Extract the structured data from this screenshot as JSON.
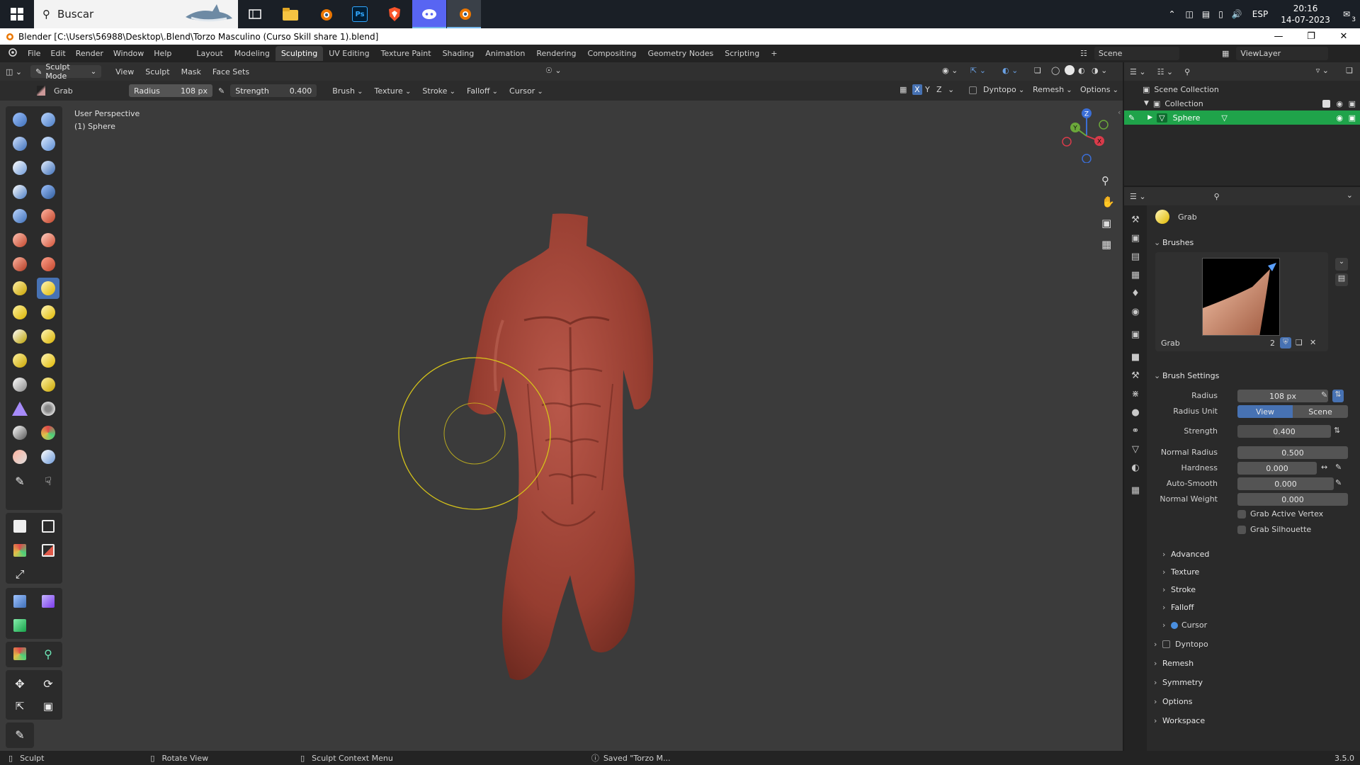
{
  "taskbar": {
    "search_placeholder": "Buscar",
    "time": "20:16",
    "date": "14-07-2023",
    "language": "ESP",
    "notifications": "3",
    "apps": [
      "task-view",
      "file-explorer",
      "blender",
      "photoshop",
      "brave",
      "discord",
      "blender-active"
    ]
  },
  "title": "Blender [C:\\Users\\56988\\Desktop\\.Blend\\Torzo Masculino (Curso Skill share 1).blend]",
  "menus": [
    "File",
    "Edit",
    "Render",
    "Window",
    "Help"
  ],
  "workspaces": [
    "Layout",
    "Modeling",
    "Sculpting",
    "UV Editing",
    "Texture Paint",
    "Shading",
    "Animation",
    "Rendering",
    "Compositing",
    "Geometry Nodes",
    "Scripting"
  ],
  "active_workspace": "Sculpting",
  "scene": "Scene",
  "view_layer": "ViewLayer",
  "header": {
    "mode": "Sculpt Mode",
    "menus": [
      "View",
      "Sculpt",
      "Mask",
      "Face Sets"
    ],
    "brush_name": "Grab",
    "radius_label": "Radius",
    "radius_value": "108 px",
    "strength_label": "Strength",
    "strength_value": "0.400",
    "dropdowns": [
      "Brush",
      "Texture",
      "Stroke",
      "Falloff",
      "Cursor"
    ],
    "axes": [
      "X",
      "Y",
      "Z"
    ],
    "right_dropdowns": [
      "Dyntopo",
      "Remesh",
      "Options"
    ]
  },
  "viewport": {
    "perspective": "User Perspective",
    "object": "(1) Sphere",
    "gizmo_axes": [
      "Z",
      "Y",
      "X"
    ]
  },
  "outliner": {
    "root": "Scene Collection",
    "collection": "Collection",
    "object": "Sphere"
  },
  "properties": {
    "brush_name": "Grab",
    "brushes_section": "Brushes",
    "brush_preview_name": "Grab",
    "brush_users": "2",
    "settings_section": "Brush Settings",
    "radius_label": "Radius",
    "radius_value": "108 px",
    "radius_unit_label": "Radius Unit",
    "unit_view": "View",
    "unit_scene": "Scene",
    "strength_label": "Strength",
    "strength_value": "0.400",
    "normal_radius_label": "Normal Radius",
    "normal_radius_value": "0.500",
    "hardness_label": "Hardness",
    "hardness_value": "0.000",
    "autosmooth_label": "Auto-Smooth",
    "autosmooth_value": "0.000",
    "normal_weight_label": "Normal Weight",
    "normal_weight_value": "0.000",
    "grab_active_vertex": "Grab Active Vertex",
    "grab_silhouette": "Grab Silhouette",
    "subsections": [
      "Advanced",
      "Texture",
      "Stroke",
      "Falloff",
      "Cursor"
    ],
    "sections": [
      "Dyntopo",
      "Remesh",
      "Symmetry",
      "Options",
      "Workspace"
    ]
  },
  "statusbar": {
    "left": "Sculpt",
    "middle": "Rotate View",
    "context": "Sculpt Context Menu",
    "message": "Saved \"Torzo M...",
    "version": "3.5.0"
  },
  "colors": {
    "accent": "#4772b3",
    "selected_green": "#1fa34a",
    "brush_circle": "#d4c21a",
    "model": "#a8483a"
  }
}
